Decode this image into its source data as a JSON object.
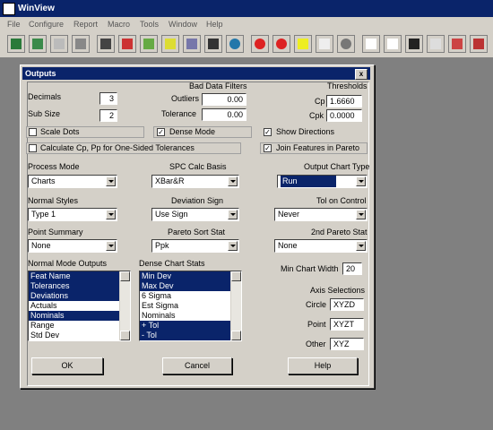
{
  "app": {
    "title": "WinView"
  },
  "menu": [
    "File",
    "Configure",
    "Report",
    "Macro",
    "Tools",
    "Window",
    "Help"
  ],
  "toolbar": {
    "icons": [
      "measure-icon",
      "connect-icon",
      "print-icon",
      "send-icon",
      "grid-icon",
      "chart-icon",
      "list-icon",
      "lightning-icon",
      "stack-icon",
      "tape-icon",
      "globe-icon",
      "apple-icon",
      "apple2-icon",
      "bolt-icon",
      "doc-icon",
      "stop-icon",
      "iges-icon",
      "dxf-icon",
      "glasses-icon",
      "num-icon",
      "tool-icon",
      "ruler-icon",
      "report-icon"
    ],
    "iges_label": "IGES\nASC",
    "dxf_label": "DXF\nASC"
  },
  "dialog": {
    "title": "Outputs",
    "close": "x",
    "decimals_label": "Decimals",
    "decimals_value": "3",
    "subsize_label": "Sub Size",
    "subsize_value": "2",
    "bad_filters_label": "Bad Data Filters",
    "outliers_label": "Outliers",
    "outliers_value": "0.00",
    "tolerance_label": "Tolerance",
    "tolerance_value": "0.00",
    "thresholds_label": "Thresholds",
    "cp_label": "Cp",
    "cp_value": "1.6660",
    "cpk_label": "Cpk",
    "cpk_value": "0.0000",
    "scale_dots_label": "Scale Dots",
    "dense_mode_label": "Dense Mode",
    "show_directions_label": "Show Directions",
    "calc_cp_label": "Calculate Cp, Pp for One-Sided Tolerances",
    "join_features_label": "Join Features in Pareto",
    "check_mark": "✓",
    "process_mode_label": "Process Mode",
    "process_mode_value": "Charts",
    "spc_calc_label": "SPC Calc Basis",
    "spc_calc_value": "XBar&R",
    "output_chart_type_label": "Output Chart Type",
    "output_chart_type_value": "Run",
    "normal_styles_label": "Normal Styles",
    "normal_styles_value": "Type 1",
    "deviation_sign_label": "Deviation Sign",
    "deviation_sign_value": "Use Sign",
    "tol_on_control_label": "Tol on Control",
    "tol_on_control_value": "Never",
    "point_summary_label": "Point Summary",
    "point_summary_value": "None",
    "pareto_sort_label": "Pareto Sort Stat",
    "pareto_sort_value": "Ppk",
    "pareto2_label": "2nd Pareto Stat",
    "pareto2_value": "None",
    "normal_outputs_label": "Normal Mode Outputs",
    "normal_outputs": [
      {
        "t": "Feat Name",
        "sel": true
      },
      {
        "t": "Tolerances",
        "sel": true
      },
      {
        "t": "Deviations",
        "sel": true
      },
      {
        "t": "Actuals",
        "sel": false
      },
      {
        "t": "Nominals",
        "sel": true
      },
      {
        "t": "Range",
        "sel": false
      },
      {
        "t": "Std Dev",
        "sel": false
      }
    ],
    "dense_stats_label": "Dense Chart Stats",
    "dense_stats": [
      {
        "t": "Min Dev",
        "sel": true
      },
      {
        "t": "Max Dev",
        "sel": true
      },
      {
        "t": "6 Sigma",
        "sel": false
      },
      {
        "t": "Est Sigma",
        "sel": false
      },
      {
        "t": "Nominals",
        "sel": false
      },
      {
        "t": "+ Tol",
        "sel": true
      },
      {
        "t": "- Tol",
        "sel": true
      }
    ],
    "min_chart_width_label": "Min Chart Width",
    "min_chart_width_value": "20",
    "axis_selections_label": "Axis Selections",
    "circle_label": "Circle",
    "circle_value": "XYZD",
    "point_label": "Point",
    "point_value": "XYZT",
    "other_label": "Other",
    "other_value": "XYZ",
    "ok_label": "OK",
    "cancel_label": "Cancel",
    "help_label": "Help"
  }
}
